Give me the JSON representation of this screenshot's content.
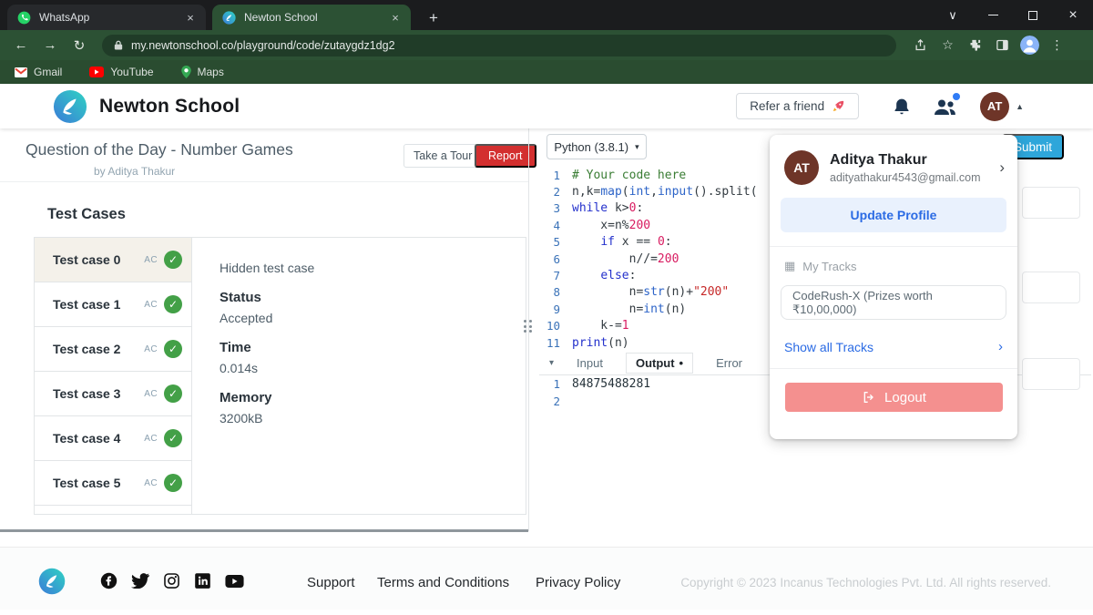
{
  "icons": {
    "check": "✓",
    "caret_up": "▲",
    "caret_down": "▾",
    "chevron_right": "›",
    "dot": "•",
    "grid": "▦",
    "kebab": "⋮",
    "back": "←",
    "forward": "→",
    "reload": "↻",
    "star": "☆",
    "window_chevron": "∨",
    "close": "×",
    "plus": "+"
  },
  "colors": {
    "accent_blue": "#2b6be4",
    "submit_blue": "#2ea6da",
    "report_red": "#d32f2f",
    "success_green": "#43a047",
    "logout_pink": "#f4908f",
    "brand_navy": "#1c3551"
  },
  "browser": {
    "tabs": [
      {
        "title": "WhatsApp"
      },
      {
        "title": "Newton School"
      }
    ],
    "active_tab": "Newton School",
    "url": "my.newtonschool.co/playground/code/zutaygdz1dg2",
    "bookmarks": [
      {
        "label": "Gmail"
      },
      {
        "label": "YouTube"
      },
      {
        "label": "Maps"
      }
    ]
  },
  "header": {
    "brand": "Newton School",
    "refer_label": "Refer a friend",
    "avatar_initials": "AT"
  },
  "question": {
    "title": "Question of the Day - Number Games",
    "author": "by Aditya Thakur",
    "take_tour_label": "Take a Tour",
    "report_label": "Report"
  },
  "test_cases": {
    "heading": "Test Cases",
    "selected_index": 0,
    "items": [
      {
        "label": "Test case 0",
        "verdict": "AC"
      },
      {
        "label": "Test case 1",
        "verdict": "AC"
      },
      {
        "label": "Test case 2",
        "verdict": "AC"
      },
      {
        "label": "Test case 3",
        "verdict": "AC"
      },
      {
        "label": "Test case 4",
        "verdict": "AC"
      },
      {
        "label": "Test case 5",
        "verdict": "AC"
      }
    ],
    "partial_next_row": true,
    "detail": {
      "hidden_note": "Hidden test case",
      "status_label": "Status",
      "status_value": "Accepted",
      "time_label": "Time",
      "time_value": "0.014s",
      "memory_label": "Memory",
      "memory_value": "3200kB"
    }
  },
  "editor": {
    "language": "Python (3.8.1)",
    "submit_label": "Submit",
    "lines": [
      [
        [
          "# Your code here",
          "com"
        ]
      ],
      [
        [
          "n,k=",
          "pln"
        ],
        [
          "map",
          "fn"
        ],
        [
          "(",
          "pln"
        ],
        [
          "int",
          "fn"
        ],
        [
          ",",
          "pln"
        ],
        [
          "input",
          "fn"
        ],
        [
          "().split(",
          "pln"
        ]
      ],
      [
        [
          "while",
          "kw"
        ],
        [
          " k>",
          "pln"
        ],
        [
          "0",
          "num"
        ],
        [
          ":",
          "pln"
        ]
      ],
      [
        [
          "    x=n%",
          "pln"
        ],
        [
          "200",
          "num"
        ]
      ],
      [
        [
          "    ",
          "pln"
        ],
        [
          "if",
          "kw"
        ],
        [
          " x == ",
          "pln"
        ],
        [
          "0",
          "num"
        ],
        [
          ":",
          "pln"
        ]
      ],
      [
        [
          "        n//=",
          "pln"
        ],
        [
          "200",
          "num"
        ]
      ],
      [
        [
          "    ",
          "pln"
        ],
        [
          "else",
          "kw"
        ],
        [
          ":",
          "pln"
        ]
      ],
      [
        [
          "        n=",
          "pln"
        ],
        [
          "str",
          "fn"
        ],
        [
          "(n)+",
          "pln"
        ],
        [
          "\"200\"",
          "str"
        ]
      ],
      [
        [
          "        n=",
          "pln"
        ],
        [
          "int",
          "fn"
        ],
        [
          "(n)",
          "pln"
        ]
      ],
      [
        [
          "    k-=",
          "pln"
        ],
        [
          "1",
          "num"
        ]
      ],
      [
        [
          "print",
          "kw"
        ],
        [
          "(n)",
          "pln"
        ]
      ]
    ]
  },
  "console": {
    "tabs": [
      {
        "label": "Input"
      },
      {
        "label": "Output"
      },
      {
        "label": "Error"
      }
    ],
    "active_tab": "Output",
    "output_lines": [
      "84875488281",
      ""
    ]
  },
  "profile_menu": {
    "name": "Aditya Thakur",
    "email": "adityathakur4543@gmail.com",
    "update_profile_label": "Update Profile",
    "my_tracks_label": "My Tracks",
    "tracks": [
      {
        "label": "CodeRush-X (Prizes worth ₹10,00,000)"
      }
    ],
    "show_all_label": "Show all Tracks",
    "logout_label": "Logout"
  },
  "footer": {
    "links": [
      {
        "label": "Support"
      },
      {
        "label": "Terms and Conditions"
      },
      {
        "label": "Privacy Policy"
      }
    ],
    "copyright": "Copyright © 2023 Incanus Technologies Pvt. Ltd. All rights reserved.",
    "social": [
      {
        "name": "facebook"
      },
      {
        "name": "twitter"
      },
      {
        "name": "instagram"
      },
      {
        "name": "linkedin"
      },
      {
        "name": "youtube"
      }
    ]
  }
}
